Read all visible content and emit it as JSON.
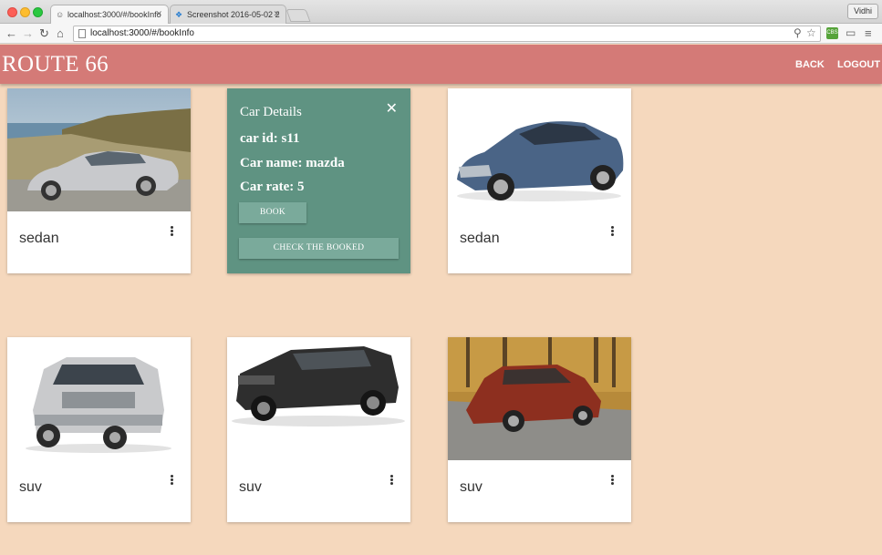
{
  "browser": {
    "tabs": [
      {
        "title": "localhost:3000/#/bookInfo",
        "active": true
      },
      {
        "title": "Screenshot 2016-05-02 2",
        "active": false
      }
    ],
    "profile": "Vidhi",
    "url": "localhost:3000/#/bookInfo",
    "extension_badge": "CBS"
  },
  "header": {
    "brand": "ROUTE 66",
    "back_label": "BACK",
    "logout_label": "LOGOUT",
    "color": "#d47a77"
  },
  "details": {
    "title": "Car Details",
    "car_id": "car id: s11",
    "car_name": "Car name: mazda",
    "car_rate": "Car rate: 5",
    "book_label": "BOOK",
    "check_label": "CHECK THE BOOKED",
    "color": "#5f9382"
  },
  "cars": [
    {
      "type": "sedan",
      "image": "silver-sedan-coast"
    },
    {
      "type": "sedan",
      "image": "blue-sedan-white"
    },
    {
      "type": "suv",
      "image": "silver-suv-white"
    },
    {
      "type": "suv",
      "image": "black-suv-white"
    },
    {
      "type": "suv",
      "image": "red-suv-autumn"
    }
  ],
  "colors": {
    "page_bg": "#f5d8bd"
  }
}
